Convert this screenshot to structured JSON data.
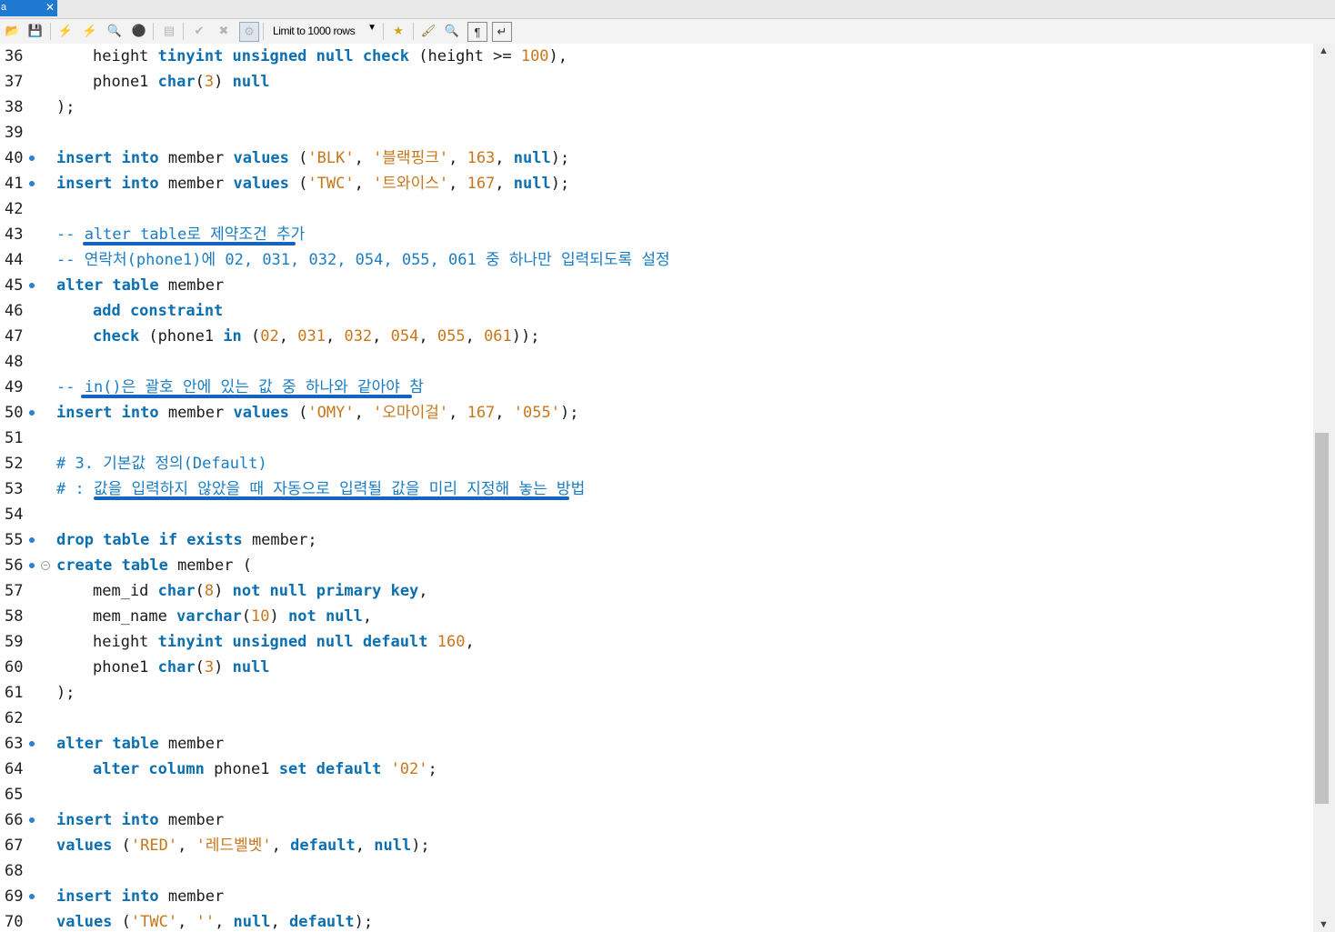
{
  "tab": {
    "label": "a",
    "close": "✕"
  },
  "toolbar": {
    "limit_label": "Limit to 1000 rows",
    "icons": [
      "folder-open-icon",
      "save-icon",
      "execute-icon",
      "execute-current-icon",
      "explain-icon",
      "stop-icon",
      "toggle-output-icon",
      "commit-icon",
      "rollback-icon",
      "autocommit-icon",
      "limit-dropdown",
      "bookmark-icon",
      "beautify-icon",
      "find-icon",
      "invisibles-icon",
      "wrap-icon"
    ]
  },
  "editor": {
    "lines": [
      {
        "n": "36",
        "marker": false,
        "fold": false,
        "indent": true,
        "tokens": [
          [
            "id",
            "height "
          ],
          [
            "ty",
            "tinyint unsigned null check"
          ],
          [
            "id",
            " (height >= "
          ],
          [
            "nm",
            "100"
          ],
          [
            "id",
            "),"
          ]
        ]
      },
      {
        "n": "37",
        "marker": false,
        "fold": false,
        "indent": true,
        "tokens": [
          [
            "id",
            "phone1 "
          ],
          [
            "ty",
            "char"
          ],
          [
            "id",
            "("
          ],
          [
            "nm",
            "3"
          ],
          [
            "id",
            ") "
          ],
          [
            "kw",
            "null"
          ]
        ]
      },
      {
        "n": "38",
        "marker": false,
        "fold": false,
        "indent": false,
        "tokens": [
          [
            "id",
            ");"
          ]
        ]
      },
      {
        "n": "39",
        "marker": false,
        "fold": false,
        "indent": false,
        "tokens": []
      },
      {
        "n": "40",
        "marker": true,
        "fold": false,
        "indent": false,
        "tokens": [
          [
            "kw",
            "insert into"
          ],
          [
            "id",
            " member "
          ],
          [
            "kw",
            "values"
          ],
          [
            "id",
            " ("
          ],
          [
            "st",
            "'BLK'"
          ],
          [
            "id",
            ", "
          ],
          [
            "st",
            "'블랙핑크'"
          ],
          [
            "id",
            ", "
          ],
          [
            "nm",
            "163"
          ],
          [
            "id",
            ", "
          ],
          [
            "kw",
            "null"
          ],
          [
            "id",
            ");"
          ]
        ]
      },
      {
        "n": "41",
        "marker": true,
        "fold": false,
        "indent": false,
        "tokens": [
          [
            "kw",
            "insert into"
          ],
          [
            "id",
            " member "
          ],
          [
            "kw",
            "values"
          ],
          [
            "id",
            " ("
          ],
          [
            "st",
            "'TWC'"
          ],
          [
            "id",
            ", "
          ],
          [
            "st",
            "'트와이스'"
          ],
          [
            "id",
            ", "
          ],
          [
            "nm",
            "167"
          ],
          [
            "id",
            ", "
          ],
          [
            "kw",
            "null"
          ],
          [
            "id",
            ");"
          ]
        ]
      },
      {
        "n": "42",
        "marker": false,
        "fold": false,
        "indent": false,
        "tokens": []
      },
      {
        "n": "43",
        "marker": false,
        "fold": false,
        "indent": false,
        "tokens": [
          [
            "cm",
            "-- alter table로 제약조건 추가"
          ]
        ]
      },
      {
        "n": "44",
        "marker": false,
        "fold": false,
        "indent": false,
        "tokens": [
          [
            "cm",
            "-- 연락처(phone1)에 02, 031, 032, 054, 055, 061 중 하나만 입력되도록 설정"
          ]
        ]
      },
      {
        "n": "45",
        "marker": true,
        "fold": false,
        "indent": false,
        "tokens": [
          [
            "kw",
            "alter table"
          ],
          [
            "id",
            " member"
          ]
        ]
      },
      {
        "n": "46",
        "marker": false,
        "fold": false,
        "indent": true,
        "tokens": [
          [
            "kw",
            "add constraint"
          ]
        ]
      },
      {
        "n": "47",
        "marker": false,
        "fold": false,
        "indent": true,
        "tokens": [
          [
            "kw",
            "check"
          ],
          [
            "id",
            " (phone1 "
          ],
          [
            "kw",
            "in"
          ],
          [
            "id",
            " ("
          ],
          [
            "nm",
            "02"
          ],
          [
            "id",
            ", "
          ],
          [
            "nm",
            "031"
          ],
          [
            "id",
            ", "
          ],
          [
            "nm",
            "032"
          ],
          [
            "id",
            ", "
          ],
          [
            "nm",
            "054"
          ],
          [
            "id",
            ", "
          ],
          [
            "nm",
            "055"
          ],
          [
            "id",
            ", "
          ],
          [
            "nm",
            "061"
          ],
          [
            "id",
            "));"
          ]
        ]
      },
      {
        "n": "48",
        "marker": false,
        "fold": false,
        "indent": false,
        "tokens": []
      },
      {
        "n": "49",
        "marker": false,
        "fold": false,
        "indent": false,
        "tokens": [
          [
            "cm",
            "-- in()은 괄호 안에 있는 값 중 하나와 같아야 참"
          ]
        ]
      },
      {
        "n": "50",
        "marker": true,
        "fold": false,
        "indent": false,
        "tokens": [
          [
            "kw",
            "insert into"
          ],
          [
            "id",
            " member "
          ],
          [
            "kw",
            "values"
          ],
          [
            "id",
            " ("
          ],
          [
            "st",
            "'OMY'"
          ],
          [
            "id",
            ", "
          ],
          [
            "st",
            "'오마이걸'"
          ],
          [
            "id",
            ", "
          ],
          [
            "nm",
            "167"
          ],
          [
            "id",
            ", "
          ],
          [
            "st",
            "'055'"
          ],
          [
            "id",
            ");"
          ]
        ]
      },
      {
        "n": "51",
        "marker": false,
        "fold": false,
        "indent": false,
        "tokens": []
      },
      {
        "n": "52",
        "marker": false,
        "fold": false,
        "indent": false,
        "tokens": [
          [
            "cm",
            "# 3. 기본값 정의(Default)"
          ]
        ]
      },
      {
        "n": "53",
        "marker": false,
        "fold": false,
        "indent": false,
        "tokens": [
          [
            "cm",
            "# : 값을 입력하지 않았을 때 자동으로 입력될 값을 미리 지정해 놓는 방법"
          ]
        ]
      },
      {
        "n": "54",
        "marker": false,
        "fold": false,
        "indent": false,
        "tokens": []
      },
      {
        "n": "55",
        "marker": true,
        "fold": false,
        "indent": false,
        "tokens": [
          [
            "kw",
            "drop table if exists"
          ],
          [
            "id",
            " member;"
          ]
        ]
      },
      {
        "n": "56",
        "marker": true,
        "fold": true,
        "indent": false,
        "tokens": [
          [
            "kw",
            "create table"
          ],
          [
            "id",
            " member ("
          ]
        ]
      },
      {
        "n": "57",
        "marker": false,
        "fold": false,
        "indent": true,
        "tokens": [
          [
            "id",
            "mem_id "
          ],
          [
            "ty",
            "char"
          ],
          [
            "id",
            "("
          ],
          [
            "nm",
            "8"
          ],
          [
            "id",
            ") "
          ],
          [
            "kw",
            "not null primary key"
          ],
          [
            "id",
            ","
          ]
        ]
      },
      {
        "n": "58",
        "marker": false,
        "fold": false,
        "indent": true,
        "tokens": [
          [
            "id",
            "mem_name "
          ],
          [
            "ty",
            "varchar"
          ],
          [
            "id",
            "("
          ],
          [
            "nm",
            "10"
          ],
          [
            "id",
            ") "
          ],
          [
            "kw",
            "not null"
          ],
          [
            "id",
            ","
          ]
        ]
      },
      {
        "n": "59",
        "marker": false,
        "fold": false,
        "indent": true,
        "tokens": [
          [
            "id",
            "height "
          ],
          [
            "ty",
            "tinyint unsigned null default"
          ],
          [
            "id",
            " "
          ],
          [
            "nm",
            "160"
          ],
          [
            "id",
            ","
          ]
        ]
      },
      {
        "n": "60",
        "marker": false,
        "fold": false,
        "indent": true,
        "tokens": [
          [
            "id",
            "phone1 "
          ],
          [
            "ty",
            "char"
          ],
          [
            "id",
            "("
          ],
          [
            "nm",
            "3"
          ],
          [
            "id",
            ") "
          ],
          [
            "kw",
            "null"
          ]
        ]
      },
      {
        "n": "61",
        "marker": false,
        "fold": false,
        "indent": false,
        "tokens": [
          [
            "id",
            ");"
          ]
        ]
      },
      {
        "n": "62",
        "marker": false,
        "fold": false,
        "indent": false,
        "tokens": []
      },
      {
        "n": "63",
        "marker": true,
        "fold": false,
        "indent": false,
        "tokens": [
          [
            "kw",
            "alter table"
          ],
          [
            "id",
            " member"
          ]
        ]
      },
      {
        "n": "64",
        "marker": false,
        "fold": false,
        "indent": true,
        "tokens": [
          [
            "kw",
            "alter column"
          ],
          [
            "id",
            " phone1 "
          ],
          [
            "kw",
            "set default"
          ],
          [
            "id",
            " "
          ],
          [
            "st",
            "'02'"
          ],
          [
            "id",
            ";"
          ]
        ]
      },
      {
        "n": "65",
        "marker": false,
        "fold": false,
        "indent": false,
        "tokens": []
      },
      {
        "n": "66",
        "marker": true,
        "fold": false,
        "indent": false,
        "tokens": [
          [
            "kw",
            "insert into"
          ],
          [
            "id",
            " member"
          ]
        ]
      },
      {
        "n": "67",
        "marker": false,
        "fold": false,
        "indent": false,
        "tokens": [
          [
            "kw",
            "values"
          ],
          [
            "id",
            " ("
          ],
          [
            "st",
            "'RED'"
          ],
          [
            "id",
            ", "
          ],
          [
            "st",
            "'레드벨벳'"
          ],
          [
            "id",
            ", "
          ],
          [
            "kw",
            "default"
          ],
          [
            "id",
            ", "
          ],
          [
            "kw",
            "null"
          ],
          [
            "id",
            ");"
          ]
        ]
      },
      {
        "n": "68",
        "marker": false,
        "fold": false,
        "indent": false,
        "tokens": []
      },
      {
        "n": "69",
        "marker": true,
        "fold": false,
        "indent": false,
        "tokens": [
          [
            "kw",
            "insert into"
          ],
          [
            "id",
            " member"
          ]
        ]
      },
      {
        "n": "70",
        "marker": false,
        "fold": false,
        "indent": false,
        "tokens": [
          [
            "kw",
            "values"
          ],
          [
            "id",
            " ("
          ],
          [
            "st",
            "'TWC'"
          ],
          [
            "id",
            ", "
          ],
          [
            "st",
            "''"
          ],
          [
            "id",
            ", "
          ],
          [
            "kw",
            "null"
          ],
          [
            "id",
            ", "
          ],
          [
            "kw",
            "default"
          ],
          [
            "id",
            ");"
          ]
        ]
      }
    ]
  },
  "scrollbar": {
    "up": "▲",
    "down": "▼"
  }
}
